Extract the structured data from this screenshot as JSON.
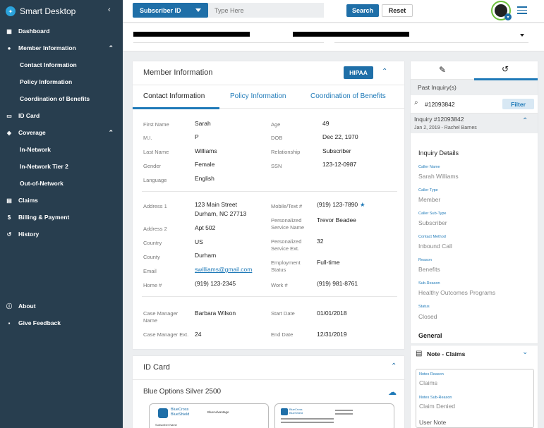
{
  "app": {
    "title": "Smart Desktop"
  },
  "sidebar": {
    "items": [
      {
        "label": "Dashboard"
      },
      {
        "label": "Member Information"
      },
      {
        "label": "Contact Information"
      },
      {
        "label": "Policy Information"
      },
      {
        "label": "Coordination of Benefits"
      },
      {
        "label": "ID Card"
      },
      {
        "label": "Coverage"
      },
      {
        "label": "In-Network"
      },
      {
        "label": "In-Network Tier 2"
      },
      {
        "label": "Out-of-Network"
      },
      {
        "label": "Claims"
      },
      {
        "label": "Billing & Payment"
      },
      {
        "label": "History"
      },
      {
        "label": "About"
      },
      {
        "label": "Give Feedback"
      }
    ]
  },
  "topbar": {
    "select_value": "Subscriber ID",
    "search_placeholder": "Type Here",
    "search_label": "Search",
    "reset_label": "Reset"
  },
  "member": {
    "title": "Member Information",
    "hipaa_label": "HIPAA",
    "tabs": [
      "Contact Information",
      "Policy Information",
      "Coordination of Benefits"
    ],
    "labels": {
      "first_name": "First Name",
      "mi": "M.I.",
      "last_name": "Last Name",
      "gender": "Gender",
      "language": "Language",
      "age": "Age",
      "dob": "DOB",
      "relationship": "Relationship",
      "ssn": "SSN",
      "address1": "Address 1",
      "address2": "Address 2",
      "country": "Country",
      "county": "County",
      "email": "Email",
      "home": "Home #",
      "mobile": "Mobile/Text #",
      "personalized_name": "Personalized Service Name",
      "personalized_ext": "Personalized Service Ext.",
      "employment": "Employment Status",
      "work": "Work #",
      "case_manager": "Case Manager Name",
      "case_manager_ext": "Case Manager Ext.",
      "start_date": "Start Date",
      "end_date": "End Date"
    },
    "values": {
      "first_name": "Sarah",
      "mi": "P",
      "last_name": "Williams",
      "gender": "Female",
      "language": "English",
      "age": "49",
      "dob": "Dec 22, 1970",
      "relationship": "Subscriber",
      "ssn": "123-12-0987",
      "address1_line1": "123 Main Street",
      "address1_line2": "Durham, NC 27713",
      "address2": "Apt 502",
      "country": "US",
      "county": "Durham",
      "email": "swilliams@gmail.com",
      "home": "(919) 123-2345",
      "mobile": "(919) 123-7890",
      "personalized_name": "Trevor Beadee",
      "personalized_ext": "32",
      "employment": "Full-time",
      "work": "(919) 981-8761",
      "case_manager": "Barbara Wilson",
      "case_manager_ext": "24",
      "start_date": "01/01/2018",
      "end_date": "12/31/2019"
    }
  },
  "idcard": {
    "title": "ID Card",
    "plan": "Blue Options Silver 2500",
    "card_front_brand": "BlueCross BlueShield",
    "card_front_product": "BlueAdvantage",
    "card_front_label": "Subscriber Name",
    "card_back_brand": "BlueCross BlueShield"
  },
  "inquiry": {
    "past_label": "Past Inquiry(s)",
    "search_value": "#12093842",
    "filter_label": "Filter",
    "title": "Inquiry #12093842",
    "subtitle": "Jan 2, 2019 - Rachel Barnes",
    "details_label": "Inquiry Details",
    "fields": [
      {
        "label": "Caller Name",
        "value": "Sarah Williams"
      },
      {
        "label": "Caller Type",
        "value": "Member"
      },
      {
        "label": "Caller Sub-Type",
        "value": "Subscriber"
      },
      {
        "label": "Contact Method",
        "value": "Inbound Call"
      },
      {
        "label": "Reason",
        "value": "Benefits"
      },
      {
        "label": "Sub-Reason",
        "value": "Healthy Outcomes Programs"
      },
      {
        "label": "Status",
        "value": "Closed"
      }
    ],
    "general_label": "General"
  },
  "note": {
    "title": "Note - Claims",
    "fields": [
      {
        "label": "Notes Reason",
        "value": "Claims"
      },
      {
        "label": "Notes Sub-Reason",
        "value": "Claim Denied"
      }
    ],
    "user_note": "User Note"
  }
}
